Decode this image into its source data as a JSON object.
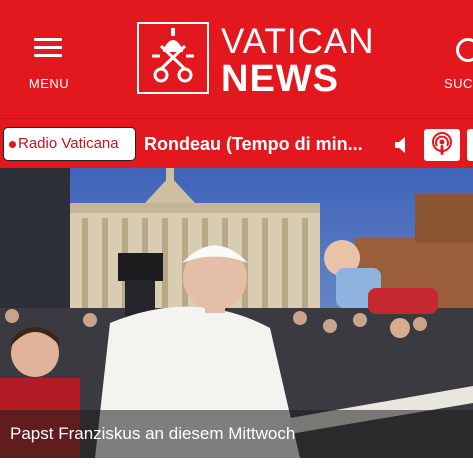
{
  "header": {
    "menu_label": "MENU",
    "search_label": "SUC",
    "logo_line1": "VATICAN",
    "logo_line2": "NEWS"
  },
  "radio": {
    "station": "Radio Vaticana",
    "track": "Rondeau (Tempo di min..."
  },
  "hero": {
    "caption": "Papst Franziskus an diesem Mittwoch"
  },
  "colors": {
    "brand_red": "#e3181f",
    "white": "#ffffff"
  },
  "icons": [
    "menu-icon",
    "vatican-emblem-icon",
    "search-icon",
    "live-dot-icon",
    "speaker-icon",
    "podcast-icon"
  ]
}
